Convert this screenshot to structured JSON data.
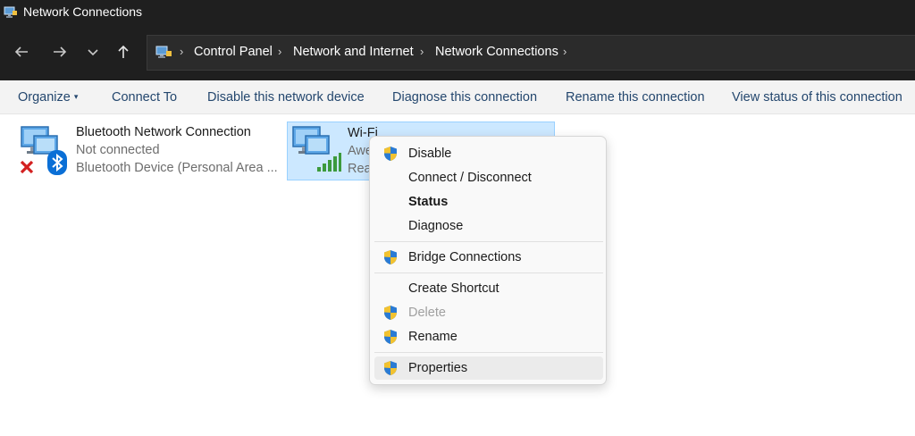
{
  "window": {
    "title": "Network Connections"
  },
  "address": {
    "crumbs": [
      "Control Panel",
      "Network and Internet",
      "Network Connections"
    ],
    "sep": "›"
  },
  "commands": {
    "organize": "Organize",
    "organize_caret": "▾",
    "connect_to": "Connect To",
    "disable_device": "Disable this network device",
    "diagnose": "Diagnose this connection",
    "rename": "Rename this connection",
    "view_status": "View status of this connection"
  },
  "items": {
    "bluetooth": {
      "name": "Bluetooth Network Connection",
      "status": "Not connected",
      "device": "Bluetooth Device (Personal Area ..."
    },
    "wifi": {
      "name": "Wi-Fi",
      "status_partial": "Awe",
      "device_partial": "Rea"
    }
  },
  "context_menu": {
    "disable": "Disable",
    "connect_disconnect": "Connect / Disconnect",
    "status": "Status",
    "diagnose": "Diagnose",
    "bridge": "Bridge Connections",
    "shortcut": "Create Shortcut",
    "delete": "Delete",
    "rename": "Rename",
    "properties": "Properties"
  },
  "colors": {
    "titlebar": "#1f1f1f",
    "selection": "#cce8ff",
    "command_text": "#24476e",
    "menu_bg": "#f9f9f9"
  },
  "icons": [
    "network-connections-icon",
    "back-arrow-icon",
    "forward-arrow-icon",
    "recent-chevron-icon",
    "up-arrow-icon",
    "control-panel-icon",
    "network-adapter-icon",
    "bluetooth-icon",
    "red-x-icon",
    "wifi-signal-icon",
    "uac-shield-icon"
  ]
}
